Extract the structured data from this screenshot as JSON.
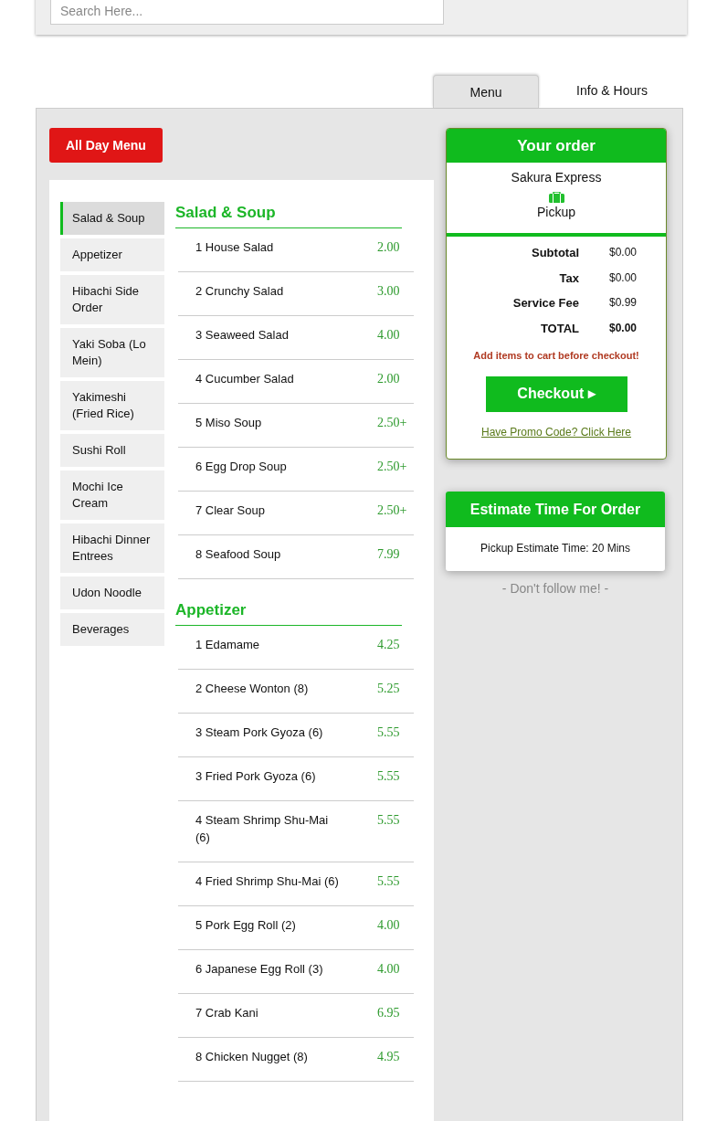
{
  "search": {
    "placeholder": "Search Here..."
  },
  "tabs": [
    {
      "label": "Menu",
      "selected": true
    },
    {
      "label": "Info & Hours",
      "selected": false
    }
  ],
  "menu_button": "All Day Menu",
  "categories": [
    {
      "label": "Salad & Soup",
      "selected": true
    },
    {
      "label": "Appetizer",
      "selected": false
    },
    {
      "label": "Hibachi Side Order",
      "selected": false
    },
    {
      "label": "Yaki Soba (Lo Mein)",
      "selected": false
    },
    {
      "label": "Yakimeshi (Fried Rice)",
      "selected": false
    },
    {
      "label": "Sushi Roll",
      "selected": false
    },
    {
      "label": "Mochi Ice Cream",
      "selected": false
    },
    {
      "label": "Hibachi Dinner Entrees",
      "selected": false
    },
    {
      "label": "Udon Noodle",
      "selected": false
    },
    {
      "label": "Beverages",
      "selected": false
    }
  ],
  "sections": [
    {
      "title": "Salad & Soup",
      "items": [
        {
          "name": "1 House Salad",
          "price": "2.00"
        },
        {
          "name": "2 Crunchy Salad",
          "price": "3.00"
        },
        {
          "name": "3 Seaweed Salad",
          "price": "4.00"
        },
        {
          "name": "4 Cucumber Salad",
          "price": "2.00"
        },
        {
          "name": "5 Miso Soup",
          "price": "2.50+"
        },
        {
          "name": "6 Egg Drop Soup",
          "price": "2.50+"
        },
        {
          "name": "7 Clear Soup",
          "price": "2.50+"
        },
        {
          "name": "8 Seafood Soup",
          "price": "7.99"
        }
      ]
    },
    {
      "title": "Appetizer",
      "items": [
        {
          "name": "1 Edamame",
          "price": "4.25"
        },
        {
          "name": "2 Cheese Wonton (8)",
          "price": "5.25"
        },
        {
          "name": "3 Steam Pork Gyoza (6)",
          "price": "5.55"
        },
        {
          "name": "3 Fried Pork Gyoza (6)",
          "price": "5.55"
        },
        {
          "name": "4 Steam Shrimp Shu-Mai (6)",
          "price": "5.55"
        },
        {
          "name": "4 Fried Shrimp Shu-Mai (6)",
          "price": "5.55"
        },
        {
          "name": "5 Pork Egg Roll (2)",
          "price": "4.00"
        },
        {
          "name": "6 Japanese Egg Roll (3)",
          "price": "4.00"
        },
        {
          "name": "7 Crab Kani",
          "price": "6.95"
        },
        {
          "name": "8 Chicken Nugget (8)",
          "price": "4.95"
        }
      ]
    }
  ],
  "order": {
    "title": "Your order",
    "restaurant": "Sakura Express",
    "mode": "Pickup",
    "totals": [
      {
        "label": "Subtotal",
        "value": "$0.00",
        "kind": "normal"
      },
      {
        "label": "Tax",
        "value": "$0.00",
        "kind": "normal"
      },
      {
        "label": "Service Fee",
        "value": "$0.99",
        "kind": "normal"
      },
      {
        "label": "TOTAL",
        "value": "$0.00",
        "kind": "total"
      }
    ],
    "warning": "Add items to cart before checkout!",
    "checkout": "Checkout ▸",
    "promo_link": "Have Promo Code? Click Here"
  },
  "estimate": {
    "title": "Estimate Time For Order",
    "text": "Pickup Estimate Time: 20 Mins"
  },
  "footer_note": "- Don't follow me! -"
}
